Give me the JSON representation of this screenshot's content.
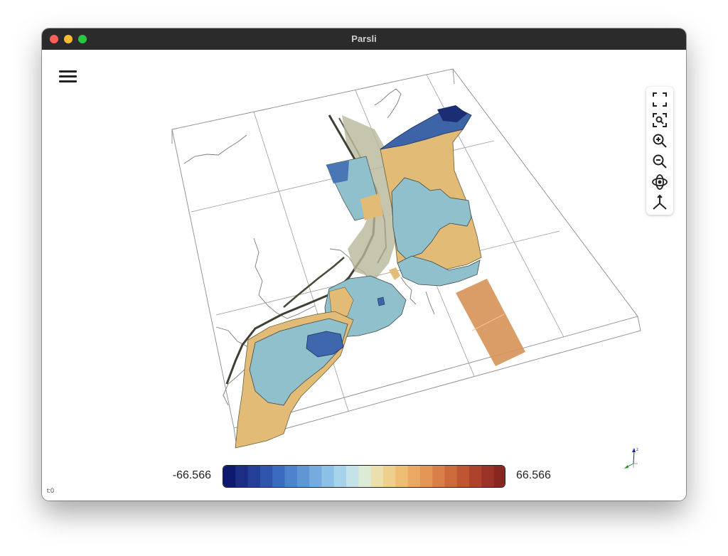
{
  "window": {
    "title": "Parsli"
  },
  "colorbar": {
    "min_label": "-66.566",
    "max_label": "66.566",
    "colors": [
      "#0d1a6e",
      "#1b2e84",
      "#253f98",
      "#2f55ad",
      "#3b6bc0",
      "#4d82cd",
      "#5f97d6",
      "#76abdf",
      "#8dc0e6",
      "#a6d3ea",
      "#c4e3e8",
      "#dcebd6",
      "#ecdfae",
      "#efcf8c",
      "#edbd75",
      "#e9a964",
      "#e39555",
      "#d98048",
      "#cd6a3c",
      "#bf5533",
      "#ad432c",
      "#9a3227",
      "#8a2622"
    ]
  },
  "toolbar": {
    "items": [
      {
        "name": "fullscreen-icon"
      },
      {
        "name": "zoom-to-region-icon"
      },
      {
        "name": "zoom-in-icon"
      },
      {
        "name": "zoom-out-icon"
      },
      {
        "name": "rotate-icon"
      },
      {
        "name": "axes-orientation-icon"
      }
    ]
  },
  "status": {
    "time": "t:0"
  },
  "axes_widget": {
    "z_label": "z"
  },
  "colors": {
    "titlebar": "#2b2b2b",
    "surface_blue": "#7fb9c9",
    "surface_tan": "#e2bc76",
    "deep_blue": "#2f4f9a",
    "patch_orange": "#d7955a"
  }
}
